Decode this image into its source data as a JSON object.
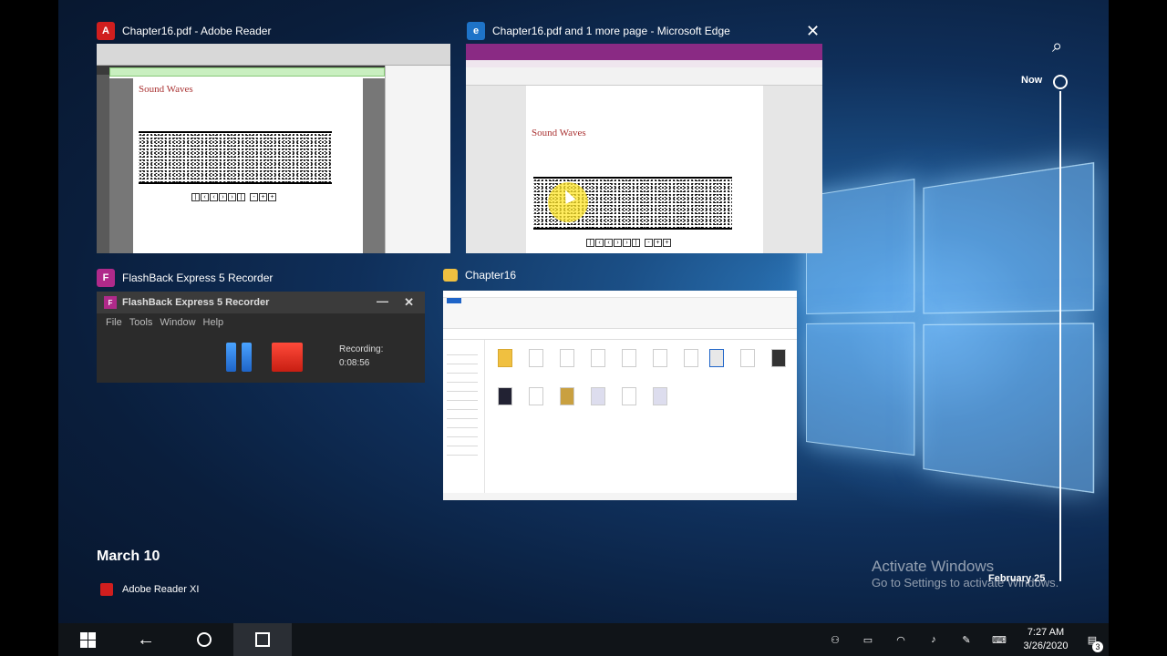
{
  "windows": {
    "adobe": {
      "title": "Chapter16.pdf - Adobe Reader",
      "heading": "Sound Waves"
    },
    "edge": {
      "title": "Chapter16.pdf and 1 more page - Microsoft Edge",
      "heading": "Sound Waves"
    },
    "flashback": {
      "title": "FlashBack Express 5 Recorder",
      "window_title": "FlashBack Express 5 Recorder",
      "menu": [
        "File",
        "Tools",
        "Window",
        "Help"
      ],
      "recording_label": "Recording:",
      "recording_time": "0:08:56"
    },
    "explorer": {
      "title": "Chapter16"
    }
  },
  "timeline": {
    "now_label": "Now",
    "date_marker": "February 25",
    "section_date": "March 10",
    "activity_item": "Adobe Reader XI"
  },
  "watermark": {
    "line1": "Activate Windows",
    "line2": "Go to Settings to activate Windows."
  },
  "tray": {
    "time": "7:27 AM",
    "date": "3/26/2020",
    "notification_count": "3"
  },
  "colors": {
    "accent_blue": "#1e64c8",
    "record_red": "#e0281a",
    "edge_purple": "#8a2a84",
    "adobe_red": "#d01e1e"
  }
}
